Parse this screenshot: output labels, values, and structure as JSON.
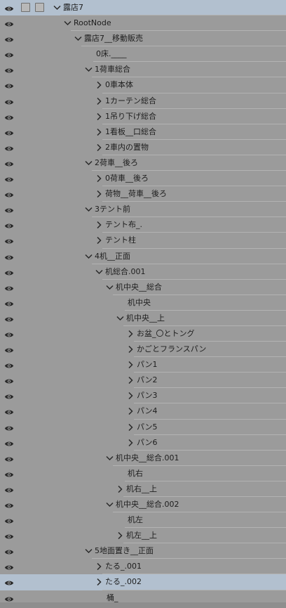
{
  "outliner": {
    "rows": [
      {
        "label": "露店7",
        "depth": 0,
        "toggle": "open",
        "checkboxes": true,
        "top": true
      },
      {
        "label": "RootNode",
        "depth": 1,
        "toggle": "open"
      },
      {
        "label": "露店7__移動販売",
        "depth": 2,
        "toggle": "open"
      },
      {
        "label": "0床.____",
        "depth": 3,
        "toggle": "none"
      },
      {
        "label": "1荷車総合",
        "depth": 3,
        "toggle": "open"
      },
      {
        "label": "0車本体",
        "depth": 4,
        "toggle": "closed"
      },
      {
        "label": "1カーテン総合",
        "depth": 4,
        "toggle": "closed"
      },
      {
        "label": "1吊り下げ総合",
        "depth": 4,
        "toggle": "closed"
      },
      {
        "label": "1看板__口総合",
        "depth": 4,
        "toggle": "closed"
      },
      {
        "label": "2車内の置物",
        "depth": 4,
        "toggle": "closed"
      },
      {
        "label": "2荷車__後ろ",
        "depth": 3,
        "toggle": "open"
      },
      {
        "label": "0荷車__後ろ",
        "depth": 4,
        "toggle": "closed"
      },
      {
        "label": "荷物__荷車__後ろ",
        "depth": 4,
        "toggle": "closed"
      },
      {
        "label": "3テント前",
        "depth": 3,
        "toggle": "open"
      },
      {
        "label": "テント布_.",
        "depth": 4,
        "toggle": "closed"
      },
      {
        "label": "テント柱",
        "depth": 4,
        "toggle": "closed"
      },
      {
        "label": "4机__正面",
        "depth": 3,
        "toggle": "open"
      },
      {
        "label": "机総合.001",
        "depth": 4,
        "toggle": "open"
      },
      {
        "label": "机中央__総合",
        "depth": 5,
        "toggle": "open"
      },
      {
        "label": "机中央",
        "depth": 6,
        "toggle": "none"
      },
      {
        "label": "机中央__上",
        "depth": 6,
        "toggle": "open"
      },
      {
        "label": "お盆_〇とトング",
        "depth": 7,
        "toggle": "closed"
      },
      {
        "label": "かごとフランスパン",
        "depth": 7,
        "toggle": "closed"
      },
      {
        "label": "パン1",
        "depth": 7,
        "toggle": "closed"
      },
      {
        "label": "パン2",
        "depth": 7,
        "toggle": "closed"
      },
      {
        "label": "パン3",
        "depth": 7,
        "toggle": "closed"
      },
      {
        "label": "パン4",
        "depth": 7,
        "toggle": "closed"
      },
      {
        "label": "パン5",
        "depth": 7,
        "toggle": "closed"
      },
      {
        "label": "パン6",
        "depth": 7,
        "toggle": "closed"
      },
      {
        "label": "机中央__総合.001",
        "depth": 5,
        "toggle": "open"
      },
      {
        "label": "机右",
        "depth": 6,
        "toggle": "none"
      },
      {
        "label": "机右__上",
        "depth": 6,
        "toggle": "closed"
      },
      {
        "label": "机中央__総合.002",
        "depth": 5,
        "toggle": "open"
      },
      {
        "label": "机左",
        "depth": 6,
        "toggle": "none"
      },
      {
        "label": "机左__上",
        "depth": 6,
        "toggle": "closed"
      },
      {
        "label": "5地面置き__正面",
        "depth": 3,
        "toggle": "open"
      },
      {
        "label": "たる_.001",
        "depth": 4,
        "toggle": "closed"
      },
      {
        "label": "たる_.002",
        "depth": 4,
        "toggle": "closed",
        "selected": true
      },
      {
        "label": "桶_",
        "depth": 4,
        "toggle": "none"
      }
    ]
  },
  "colors": {
    "background": "#9b9b9b",
    "selected_row": "#b2c0cf",
    "text": "#1d1d1d",
    "icon": "#2a2a2a"
  },
  "icons": {
    "visibility": "eye-icon",
    "expanded": "chevron-down-icon",
    "collapsed": "chevron-right-icon"
  }
}
